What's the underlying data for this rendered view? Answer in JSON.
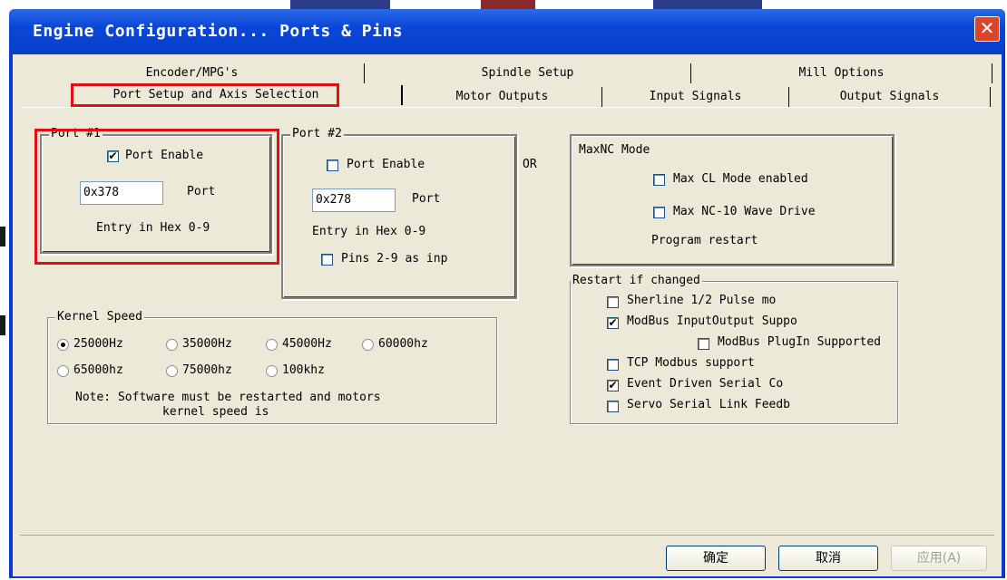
{
  "window": {
    "title": "Engine Configuration... Ports & Pins",
    "close_glyph": "✕"
  },
  "tabs_row1": [
    "Encoder/MPG's",
    "Spindle Setup",
    "Mill Options"
  ],
  "tabs_row2": [
    "Port Setup and Axis Selection",
    "Motor Outputs",
    "Input Signals",
    "Output Signals"
  ],
  "port1": {
    "legend": "Port #1",
    "enable_label": "Port Enable",
    "enabled": true,
    "address": "0x378",
    "port_label": "Port",
    "hint": "Entry in Hex 0-9"
  },
  "port2": {
    "legend": "Port #2",
    "enable_label": "Port Enable",
    "enabled": false,
    "address": "0x278",
    "port_label": "Port",
    "hint": "Entry in Hex 0-9",
    "pins_label": "Pins 2-9 as inp",
    "pins_checked": false
  },
  "or_label": "OR",
  "maxnc": {
    "legend": "MaxNC Mode",
    "cl_label": "Max CL Mode enabled",
    "nc10_label": "Max NC-10 Wave Drive",
    "restart_note": "Program restart"
  },
  "kernel": {
    "legend": "Kernel Speed",
    "options": [
      "25000Hz",
      "35000Hz",
      "45000Hz",
      "60000hz",
      "65000hz",
      "75000hz",
      "100khz"
    ],
    "selected": "25000Hz",
    "note_line1": "Note: Software must be restarted and motors",
    "note_line2": "kernel speed is"
  },
  "restart": {
    "legend": "Restart if changed",
    "sherline": "Sherline 1/2 Pulse mo",
    "modbus_io": "ModBus InputOutput Suppo",
    "modbus_plugin": "ModBus PlugIn Supported",
    "tcp_modbus": "TCP Modbus support",
    "event_serial": "Event Driven Serial Co",
    "servo_serial": "Servo Serial Link Feedb"
  },
  "buttons": {
    "ok": "确定",
    "cancel": "取消",
    "apply": "应用(A)"
  },
  "check_glyph": "✔"
}
